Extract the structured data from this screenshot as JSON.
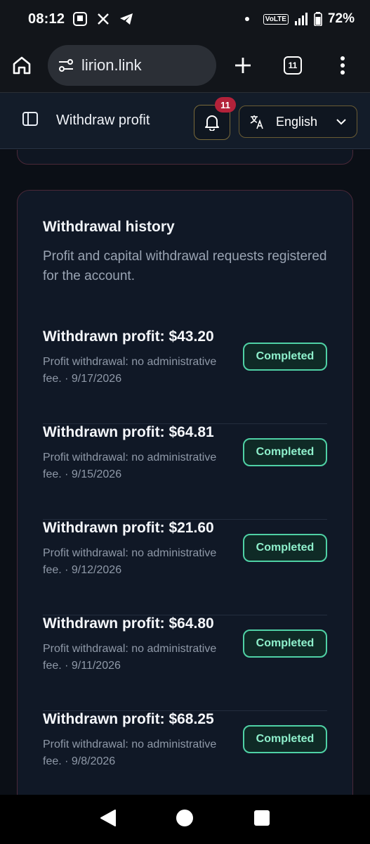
{
  "status_bar": {
    "time": "08:12",
    "volte": "VoLTE",
    "battery": "72%"
  },
  "browser": {
    "url": "lirion.link",
    "tab_count": "11"
  },
  "header": {
    "title": "Withdraw profit",
    "notifications_count": "11",
    "language": "English"
  },
  "history": {
    "title": "Withdrawal history",
    "subtitle": "Profit and capital withdrawal requests registered for the account.",
    "items": [
      {
        "amount": "Withdrawn profit: $43.20",
        "desc": "Profit withdrawal: no administrative fee. · 9/17/2026",
        "status": "Completed"
      },
      {
        "amount": "Withdrawn profit: $64.81",
        "desc": "Profit withdrawal: no administrative fee. · 9/15/2026",
        "status": "Completed"
      },
      {
        "amount": "Withdrawn profit: $21.60",
        "desc": "Profit withdrawal: no administrative fee. · 9/12/2026",
        "status": "Completed"
      },
      {
        "amount": "Withdrawn profit: $64.80",
        "desc": "Profit withdrawal: no administrative fee. · 9/11/2026",
        "status": "Completed"
      },
      {
        "amount": "Withdrawn profit: $68.25",
        "desc": "Profit withdrawal: no administrative fee. · 9/8/2026",
        "status": "Completed"
      }
    ]
  },
  "colors": {
    "accent_green": "#4fd1a5",
    "badge_red": "#b3223a",
    "background": "#0b0f16"
  }
}
